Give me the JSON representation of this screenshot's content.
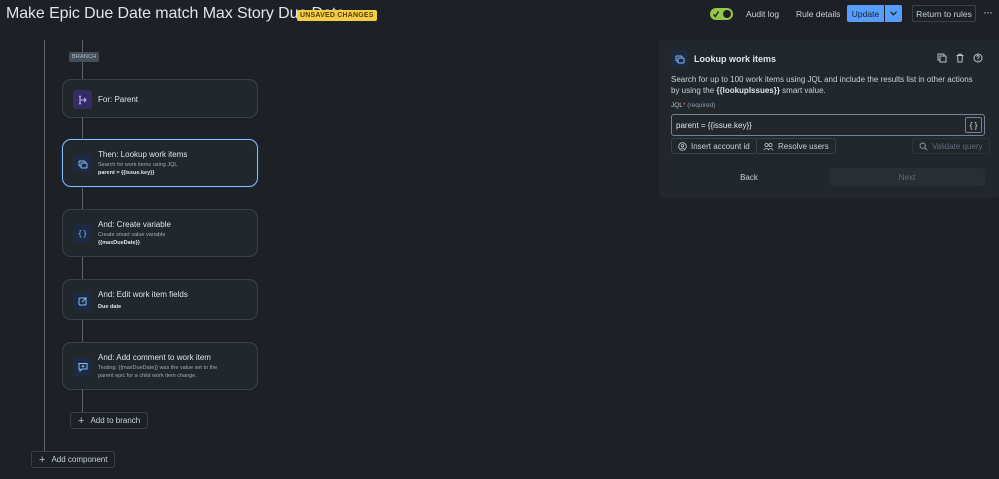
{
  "header": {
    "title": "Make Epic Due Date match Max Story Due Date",
    "badge": "UNSAVED CHANGES",
    "audit_log": "Audit log",
    "rule_details": "Rule details",
    "update": "Update",
    "return": "Return to rules",
    "more": "···",
    "toggle_on": true
  },
  "canvas": {
    "branch_tag": "BRANCH",
    "cards": [
      {
        "title": "For: Parent",
        "icon": "branch-icon"
      },
      {
        "title": "Then: Lookup work items",
        "sub1": "Search for work items using JQL",
        "sub2": "parent = {{issue.key}}",
        "icon": "lookup-icon"
      },
      {
        "title": "And: Create variable",
        "sub1": "Create smart value variable",
        "sub2": "{{maxDueDate}}",
        "icon": "braces-icon"
      },
      {
        "title": "And: Edit work item fields",
        "sub2": "Due date",
        "icon": "edit-icon"
      },
      {
        "title": "And: Add comment to work item",
        "sub1": "Testing: {{maxDueDate}} was the value set to the",
        "sub1b": "parent epic for a child work item change.",
        "icon": "comment-icon"
      }
    ],
    "add_to_branch": "Add to branch",
    "add_component": "Add component"
  },
  "panel": {
    "title": "Lookup work items",
    "desc_pre": "Search for up to 100 work items using JQL and include the results list in other actions by using the ",
    "desc_bold": "{{lookupIssues}}",
    "desc_post": " smart value.",
    "jql_label": "JQL",
    "jql_req": "*",
    "jql_required": "(required)",
    "jql_value": "parent = {{issue.key}}",
    "braces": "{ }",
    "insert_account": "Insert account id",
    "resolve_users": "Resolve users",
    "validate_query": "Validate query",
    "back": "Back",
    "next": "Next"
  },
  "colors": {
    "background": "#1d2125",
    "accent": "#579dff",
    "badge": "#f5cd47",
    "toggle": "#94c748"
  }
}
